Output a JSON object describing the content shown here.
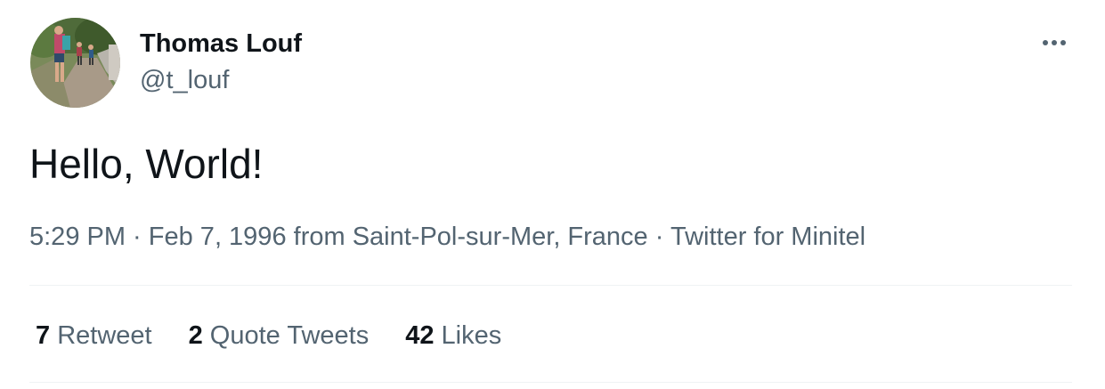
{
  "author": {
    "display_name": "Thomas Louf",
    "handle": "@t_louf",
    "avatar_icon": "profile-photo-hikers-on-path"
  },
  "tweet": {
    "text": "Hello, World!",
    "time": "5:29 PM",
    "separator1": " · ",
    "date": "Feb 7, 1996",
    "location_prefix": " from ",
    "location": "Saint-Pol-sur-Mer, France",
    "separator2": " · ",
    "source": "Twitter for Minitel"
  },
  "stats": {
    "retweets": {
      "count": "7",
      "label": "Retweet"
    },
    "quotes": {
      "count": "2",
      "label": "Quote Tweets"
    },
    "likes": {
      "count": "42",
      "label": "Likes"
    }
  },
  "colors": {
    "text_primary": "#0f1419",
    "text_secondary": "#536471",
    "divider": "#eff3f4"
  }
}
